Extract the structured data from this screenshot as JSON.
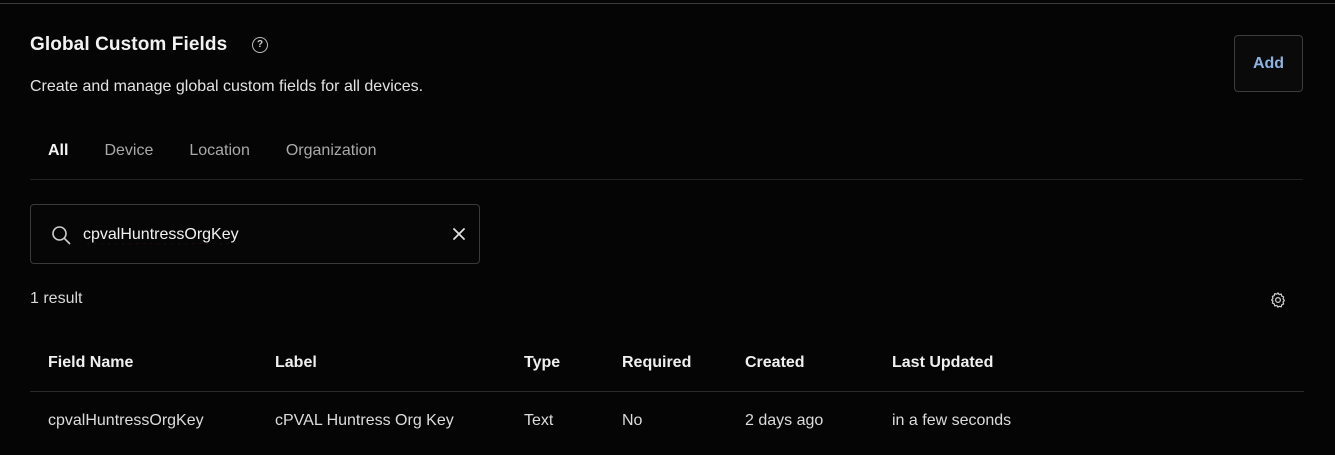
{
  "header": {
    "title": "Global Custom Fields",
    "subtitle": "Create and manage global custom fields for all devices.",
    "help_icon": "question-circle-icon",
    "add_label": "Add"
  },
  "tabs": [
    {
      "label": "All",
      "active": true
    },
    {
      "label": "Device",
      "active": false
    },
    {
      "label": "Location",
      "active": false
    },
    {
      "label": "Organization",
      "active": false
    }
  ],
  "search": {
    "value": "cpvalHuntressOrgKey",
    "icon": "search-icon",
    "clear_icon": "close-icon"
  },
  "results": {
    "count_text": "1 result",
    "settings_icon": "gear-icon"
  },
  "table": {
    "columns": [
      "Field Name",
      "Label",
      "Type",
      "Required",
      "Created",
      "Last Updated"
    ],
    "rows": [
      [
        "cpvalHuntressOrgKey",
        "cPVAL Huntress Org Key",
        "Text",
        "No",
        "2 days ago",
        "in a few seconds"
      ]
    ]
  },
  "colors": {
    "background": "#050505",
    "accent": "#8fb3e0",
    "border": "#3a3a3a"
  }
}
